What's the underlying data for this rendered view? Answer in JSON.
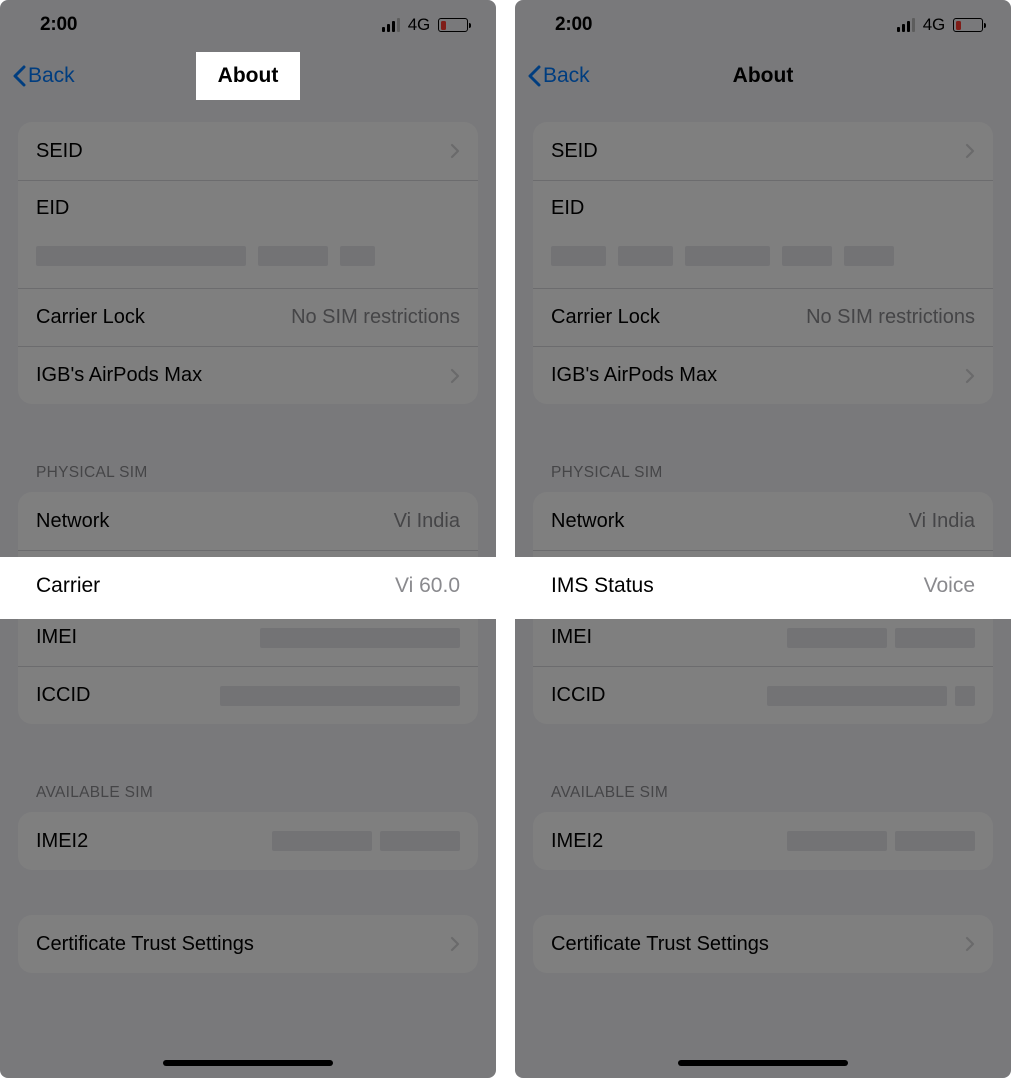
{
  "left": {
    "status": {
      "time": "2:00",
      "network": "4G"
    },
    "nav": {
      "back": "Back",
      "title": "About"
    },
    "group1": {
      "seid": "SEID",
      "eid": "EID",
      "carrier_lock": {
        "label": "Carrier Lock",
        "value": "No SIM restrictions"
      },
      "airpods": "IGB's AirPods Max"
    },
    "physical_header": "PHYSICAL SIM",
    "physical": {
      "network": {
        "label": "Network",
        "value": "Vi India"
      },
      "carrier": {
        "label": "Carrier",
        "value": "Vi 60.0"
      },
      "imei": "IMEI",
      "iccid": "ICCID"
    },
    "available_header": "AVAILABLE SIM",
    "available": {
      "imei2": "IMEI2"
    },
    "cert": "Certificate Trust Settings"
  },
  "right": {
    "status": {
      "time": "2:00",
      "network": "4G"
    },
    "nav": {
      "back": "Back",
      "title": "About"
    },
    "group1": {
      "seid": "SEID",
      "eid": "EID",
      "carrier_lock": {
        "label": "Carrier Lock",
        "value": "No SIM restrictions"
      },
      "airpods": "IGB's AirPods Max"
    },
    "physical_header": "PHYSICAL SIM",
    "physical": {
      "network": {
        "label": "Network",
        "value": "Vi India"
      },
      "ims": {
        "label": "IMS Status",
        "value": "Voice"
      },
      "imei": "IMEI",
      "iccid": "ICCID"
    },
    "available_header": "AVAILABLE SIM",
    "available": {
      "imei2": "IMEI2"
    },
    "cert": "Certificate Trust Settings"
  }
}
